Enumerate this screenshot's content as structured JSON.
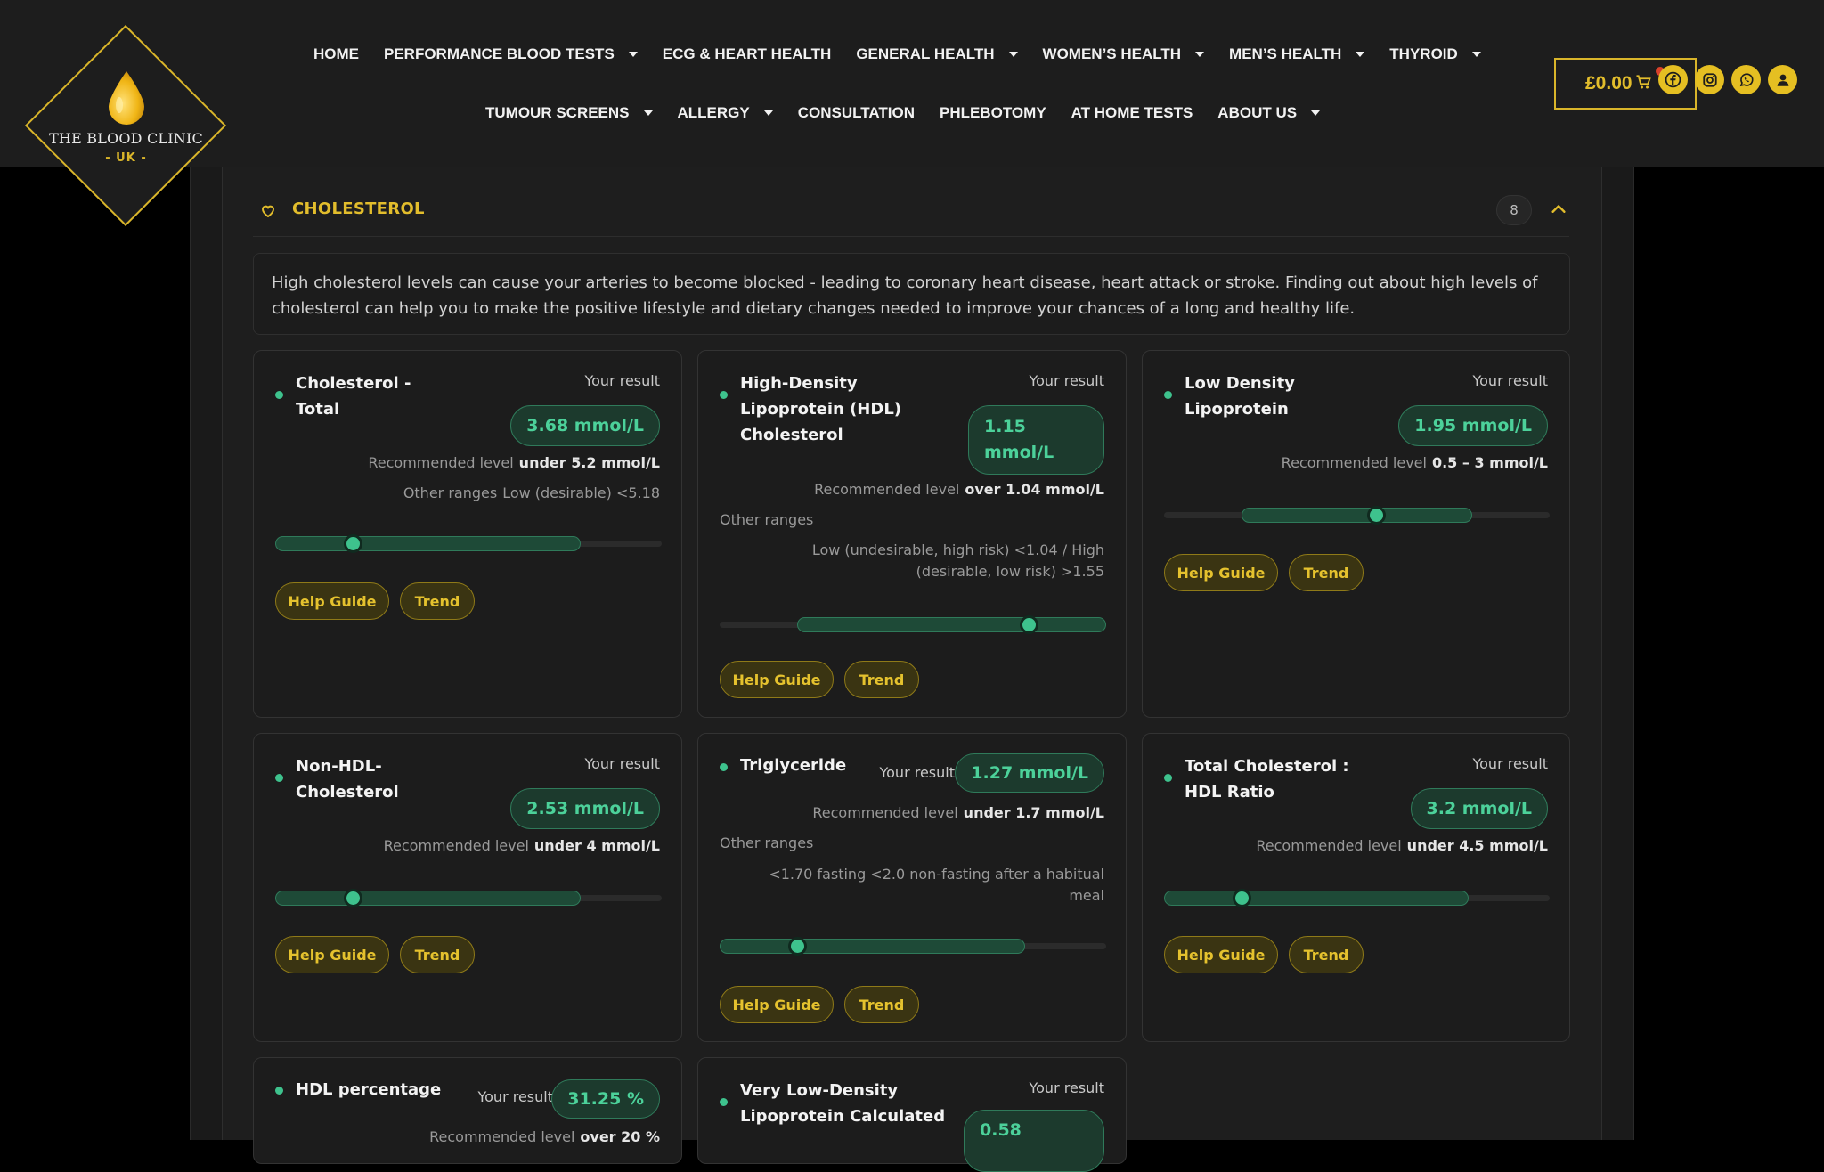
{
  "brand": {
    "name": "THE BLOOD CLINIC",
    "sub": "- UK -"
  },
  "nav": {
    "row1": [
      {
        "label": "HOME",
        "dropdown": false
      },
      {
        "label": "PERFORMANCE BLOOD TESTS",
        "dropdown": true
      },
      {
        "label": "ECG & HEART HEALTH",
        "dropdown": false
      },
      {
        "label": "GENERAL HEALTH",
        "dropdown": true
      },
      {
        "label": "WOMEN’S HEALTH",
        "dropdown": true
      },
      {
        "label": "MEN’S HEALTH",
        "dropdown": true
      },
      {
        "label": "THYROID",
        "dropdown": true
      }
    ],
    "row2": [
      {
        "label": "TUMOUR SCREENS",
        "dropdown": true
      },
      {
        "label": "ALLERGY",
        "dropdown": true
      },
      {
        "label": "CONSULTATION",
        "dropdown": false
      },
      {
        "label": "PHLEBOTOMY",
        "dropdown": false
      },
      {
        "label": "AT HOME TESTS",
        "dropdown": false
      },
      {
        "label": "ABOUT US",
        "dropdown": true
      }
    ]
  },
  "cart": {
    "amount": "£0.00",
    "icon": "cart-icon"
  },
  "social": [
    "facebook-icon",
    "instagram-icon",
    "whatsapp-icon",
    "user-icon"
  ],
  "colors": {
    "accent": "#e2bd2c",
    "result_green": "#3ec28d",
    "background": "#1e1e1e"
  },
  "section": {
    "title": "CHOLESTEROL",
    "count": "8",
    "intro": "High cholesterol levels can cause your arteries to become blocked - leading to coronary heart disease, heart attack or stroke. Finding out about high levels of cholesterol can help you to make the positive lifestyle and dietary changes needed to improve your chances of a long and healthy life."
  },
  "labels": {
    "your_result": "Your result",
    "recommended": "Recommended level",
    "other_ranges": "Other ranges",
    "help_guide": "Help Guide",
    "trend": "Trend"
  },
  "cards": [
    {
      "title": "Cholesterol - Total",
      "result": "3.68 mmol/L",
      "recommended": "under 5.2 mmol/L",
      "other": "Low (desirable) <5.18",
      "band": [
        0,
        0.79
      ],
      "marker": 0.2
    },
    {
      "title": "High-Density Lipoprotein (HDL) Cholesterol",
      "result": "1.15 mmol/L",
      "recommended": "over 1.04 mmol/L",
      "other": "Low (undesirable, high risk) <1.04 / High (desirable, low risk) >1.55",
      "band": [
        0.2,
        1.0
      ],
      "marker": 0.8
    },
    {
      "title": "Low Density Lipoprotein",
      "result": "1.95 mmol/L",
      "recommended": "0.5 – 3 mmol/L",
      "other": "",
      "band": [
        0.2,
        0.8
      ],
      "marker": 0.55
    },
    {
      "title": "Non-HDL-Cholesterol",
      "result": "2.53 mmol/L",
      "recommended": "under 4 mmol/L",
      "other": "",
      "band": [
        0,
        0.79
      ],
      "marker": 0.2
    },
    {
      "title": "Triglyceride",
      "result": "1.27 mmol/L",
      "recommended": "under 1.7 mmol/L",
      "other": "<1.70 fasting <2.0 non-fasting after a habitual meal",
      "band": [
        0,
        0.79
      ],
      "marker": 0.2
    },
    {
      "title": "Total Cholesterol : HDL Ratio",
      "result": "3.2 mmol/L",
      "recommended": "under 4.5 mmol/L",
      "other": "",
      "band": [
        0,
        0.79
      ],
      "marker": 0.2
    },
    {
      "title": "HDL percentage",
      "result": "31.25 %",
      "recommended": "over 20 %",
      "other": ""
    },
    {
      "title": "Very Low-Density Lipoprotein Calculated",
      "result": "0.58",
      "recommended": "",
      "other": ""
    }
  ]
}
